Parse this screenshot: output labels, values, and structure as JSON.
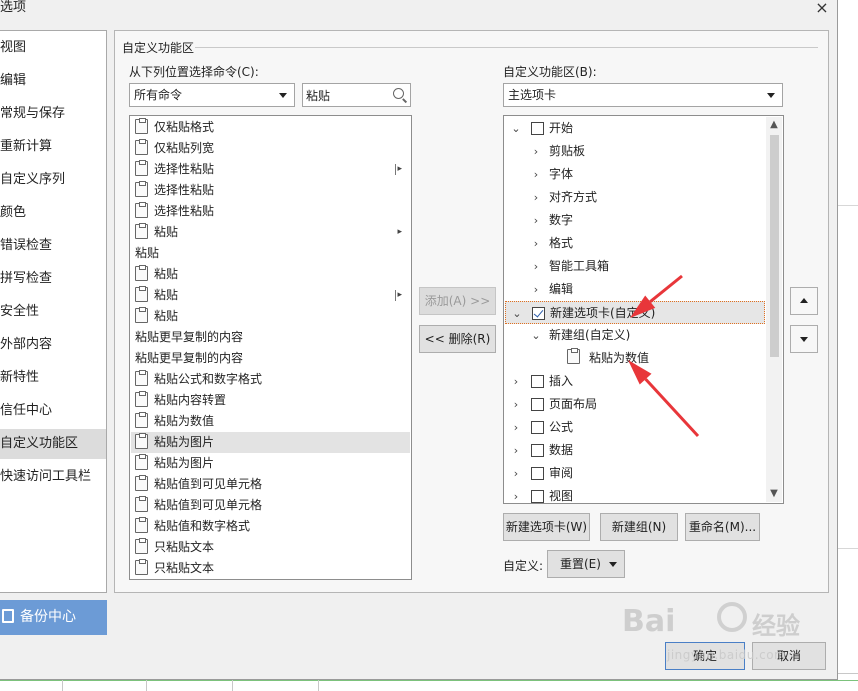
{
  "dialog": {
    "title": "选项",
    "close": "×"
  },
  "nav": {
    "items": [
      "视图",
      "编辑",
      "常规与保存",
      "重新计算",
      "自定义序列",
      "颜色",
      "错误检查",
      "拼写检查",
      "安全性",
      "外部内容",
      "新特性",
      "信任中心",
      "自定义功能区",
      "快速访问工具栏"
    ],
    "active_index": 12,
    "backup_label": "备份中心"
  },
  "panel": {
    "section_title": "自定义功能区",
    "choose_label": "从下列位置选择命令(C):",
    "choose_value": "所有命令",
    "search_value": "粘贴",
    "ribbon_label": "自定义功能区(B):",
    "ribbon_value": "主选项卡",
    "commands": [
      {
        "label": "仅粘贴格式",
        "icon": true
      },
      {
        "label": "仅粘贴列宽",
        "icon": true
      },
      {
        "label": "选择性粘贴",
        "icon": true,
        "marker": "bar"
      },
      {
        "label": "选择性粘贴",
        "icon": true
      },
      {
        "label": "选择性粘贴",
        "icon": true
      },
      {
        "label": "粘贴",
        "icon": true,
        "marker": "sub"
      },
      {
        "label": "粘贴",
        "icon": false
      },
      {
        "label": "粘贴",
        "icon": true
      },
      {
        "label": "粘贴",
        "icon": true,
        "marker": "bar"
      },
      {
        "label": "粘贴",
        "icon": true
      },
      {
        "label": "粘贴更早复制的内容",
        "icon": false
      },
      {
        "label": "粘贴更早复制的内容",
        "icon": false
      },
      {
        "label": "粘贴公式和数字格式",
        "icon": true
      },
      {
        "label": "粘贴内容转置",
        "icon": true
      },
      {
        "label": "粘贴为数值",
        "icon": true
      },
      {
        "label": "粘贴为图片",
        "icon": true,
        "selected": true
      },
      {
        "label": "粘贴为图片",
        "icon": true
      },
      {
        "label": "粘贴值到可见单元格",
        "icon": true
      },
      {
        "label": "粘贴值到可见单元格",
        "icon": true
      },
      {
        "label": "粘贴值和数字格式",
        "icon": true
      },
      {
        "label": "只粘贴文本",
        "icon": true
      },
      {
        "label": "只粘贴文本",
        "icon": true
      }
    ],
    "add_button": "添加(A) >>",
    "remove_button": "<< 删除(R)",
    "tree": [
      {
        "label": "开始",
        "level": 0,
        "chev": "⌄",
        "checkbox": true,
        "checked": false
      },
      {
        "label": "剪贴板",
        "level": 1,
        "chev": "›"
      },
      {
        "label": "字体",
        "level": 1,
        "chev": "›"
      },
      {
        "label": "对齐方式",
        "level": 1,
        "chev": "›"
      },
      {
        "label": "数字",
        "level": 1,
        "chev": "›"
      },
      {
        "label": "格式",
        "level": 1,
        "chev": "›"
      },
      {
        "label": "智能工具箱",
        "level": 1,
        "chev": "›"
      },
      {
        "label": "编辑",
        "level": 1,
        "chev": "›"
      },
      {
        "label": "新建选项卡(自定义)",
        "level": 0,
        "chev": "⌄",
        "checkbox": true,
        "checked": true,
        "selected": true
      },
      {
        "label": "新建组(自定义)",
        "level": 1,
        "chev": "⌄"
      },
      {
        "label": "粘贴为数值",
        "level": 2,
        "icon": true
      },
      {
        "label": "插入",
        "level": 0,
        "chev": "›",
        "checkbox": true,
        "checked": false
      },
      {
        "label": "页面布局",
        "level": 0,
        "chev": "›",
        "checkbox": true,
        "checked": false
      },
      {
        "label": "公式",
        "level": 0,
        "chev": "›",
        "checkbox": true,
        "checked": false
      },
      {
        "label": "数据",
        "level": 0,
        "chev": "›",
        "checkbox": true,
        "checked": false
      },
      {
        "label": "审阅",
        "level": 0,
        "chev": "›",
        "checkbox": true,
        "checked": false
      },
      {
        "label": "视图",
        "level": 0,
        "chev": "›",
        "checkbox": true,
        "checked": false
      }
    ],
    "new_tab_button": "新建选项卡(W)",
    "new_group_button": "新建组(N)",
    "rename_button": "重命名(M)...",
    "customize_label": "自定义:",
    "reset_button": "重置(E)"
  },
  "footer": {
    "ok": "确定",
    "cancel": "取消"
  },
  "watermark": {
    "brand": "Bai",
    "brand2": "经验",
    "url": "jingyan.baidu.com"
  },
  "annotation_color": "#e8363a"
}
